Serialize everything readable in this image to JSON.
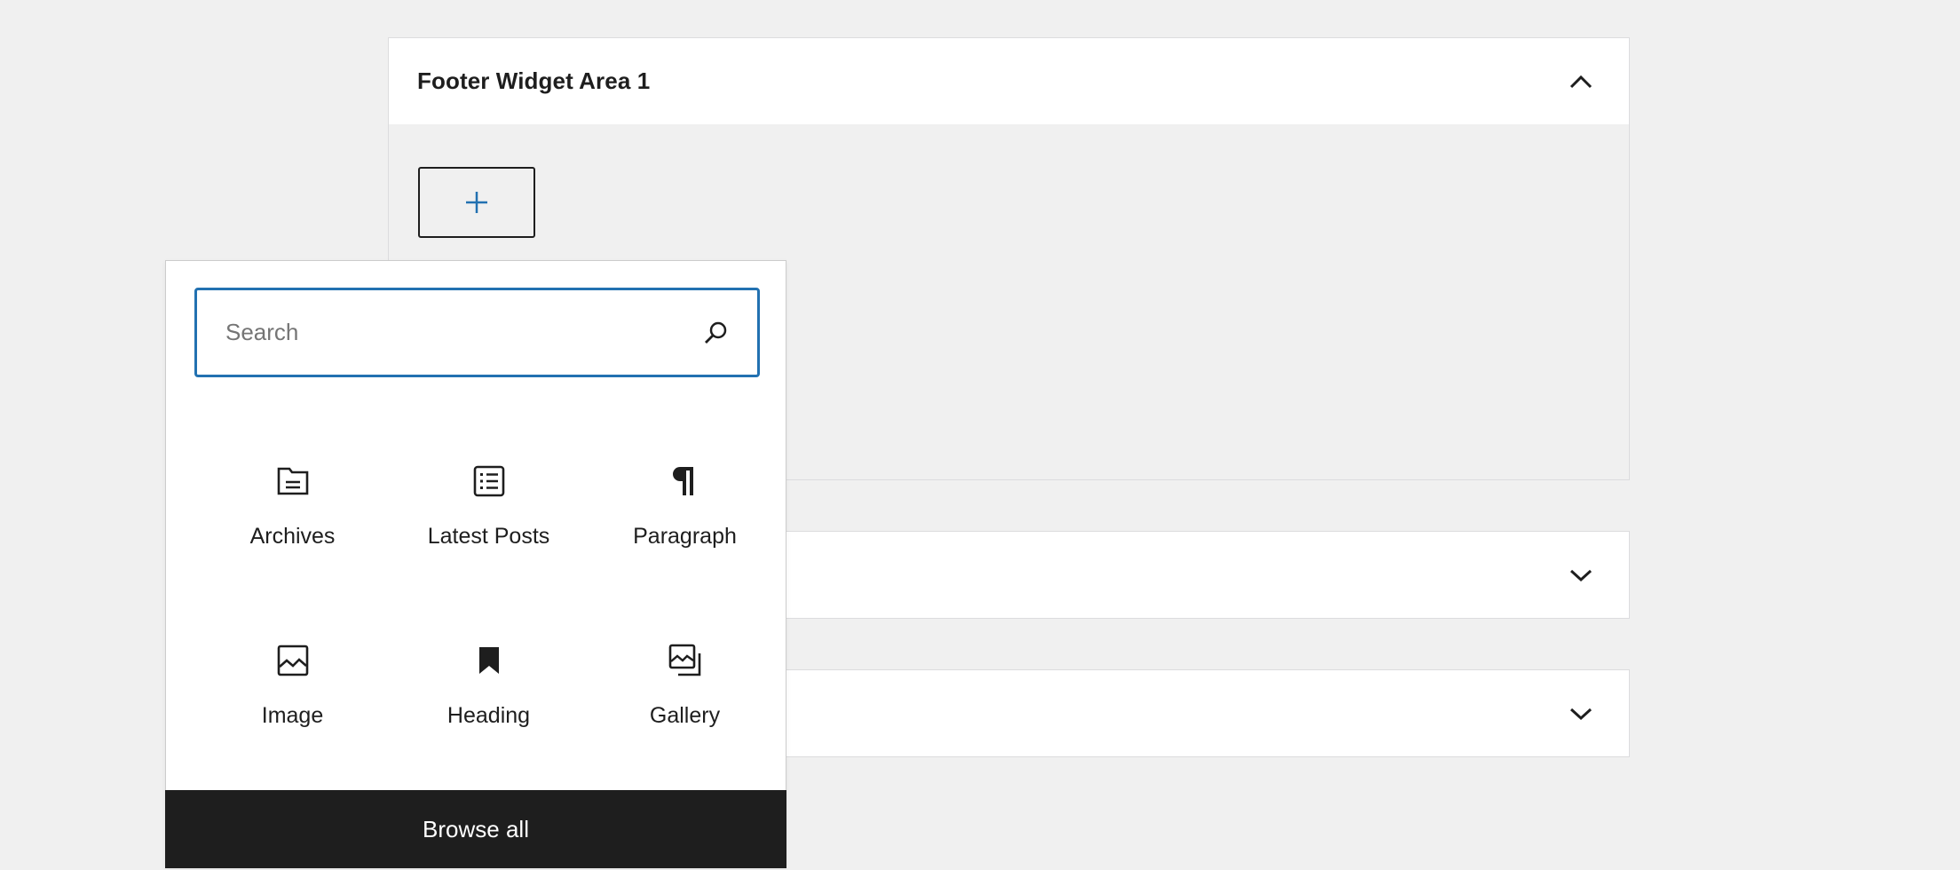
{
  "widget_areas": [
    {
      "title": "Footer Widget Area 1",
      "expanded": true,
      "toggle_icon": "chevron-up-icon"
    },
    {
      "title": "",
      "expanded": false,
      "toggle_icon": "chevron-down-icon"
    },
    {
      "title": "",
      "expanded": false,
      "toggle_icon": "chevron-down-icon"
    }
  ],
  "add_block_icon": "plus-icon",
  "inserter": {
    "search_placeholder": "Search",
    "search_icon": "search-icon",
    "blocks": [
      {
        "label": "Archives",
        "icon": "archive-icon"
      },
      {
        "label": "Latest Posts",
        "icon": "post-list-icon"
      },
      {
        "label": "Paragraph",
        "icon": "paragraph-icon"
      },
      {
        "label": "Image",
        "icon": "image-icon"
      },
      {
        "label": "Heading",
        "icon": "bookmark-icon"
      },
      {
        "label": "Gallery",
        "icon": "gallery-icon"
      }
    ],
    "browse_all_label": "Browse all"
  },
  "colors": {
    "accent": "#2271b1",
    "background": "#f0f0f0",
    "dark": "#1e1e1e"
  }
}
